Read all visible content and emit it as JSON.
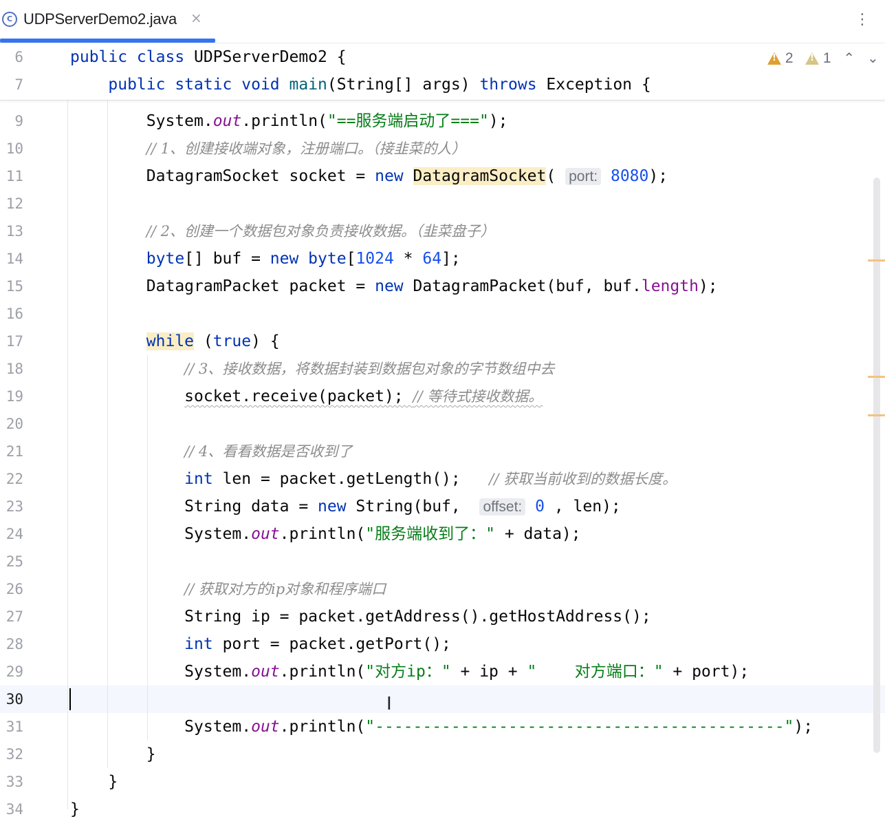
{
  "tab": {
    "icon": "java-class-icon",
    "title": "UDPServerDemo2.java",
    "close": "×"
  },
  "toolbar": {
    "more": "⋮"
  },
  "inspections": {
    "warnings": "2",
    "weak_warnings": "1",
    "up": "⌃",
    "down": "⌄"
  },
  "sticky": [
    {
      "n": "6",
      "code": "public class UDPServerDemo2 {"
    },
    {
      "n": "7",
      "code": "    public static void main(String[] args) throws Exception {"
    }
  ],
  "lines": [
    {
      "n": "9",
      "code": "        System.out.println(\"==服务端启动了===\");"
    },
    {
      "n": "10",
      "code": "        // 1、创建接收端对象，注册端口。（接韭菜的人）"
    },
    {
      "n": "11",
      "code": "        DatagramSocket socket = new DatagramSocket( port: 8080);"
    },
    {
      "n": "12",
      "code": ""
    },
    {
      "n": "13",
      "code": "        // 2、创建一个数据包对象负责接收数据。（韭菜盘子）"
    },
    {
      "n": "14",
      "code": "        byte[] buf = new byte[1024 * 64];"
    },
    {
      "n": "15",
      "code": "        DatagramPacket packet = new DatagramPacket(buf, buf.length);"
    },
    {
      "n": "16",
      "code": ""
    },
    {
      "n": "17",
      "code": "        while (true) {"
    },
    {
      "n": "18",
      "code": "            // 3、接收数据，将数据封装到数据包对象的字节数组中去"
    },
    {
      "n": "19",
      "code": "            socket.receive(packet); // 等待式接收数据。"
    },
    {
      "n": "20",
      "code": ""
    },
    {
      "n": "21",
      "code": "            // 4、看看数据是否收到了"
    },
    {
      "n": "22",
      "code": "            int len = packet.getLength();   // 获取当前收到的数据长度。"
    },
    {
      "n": "23",
      "code": "            String data = new String(buf,  offset: 0 , len);"
    },
    {
      "n": "24",
      "code": "            System.out.println(\"服务端收到了：\" + data);"
    },
    {
      "n": "25",
      "code": ""
    },
    {
      "n": "26",
      "code": "            // 获取对方的ip对象和程序端口"
    },
    {
      "n": "27",
      "code": "            String ip = packet.getAddress().getHostAddress();"
    },
    {
      "n": "28",
      "code": "            int port = packet.getPort();"
    },
    {
      "n": "29",
      "code": "            System.out.println(\"对方ip：\" + ip + \"    对方端口：\" + port);"
    },
    {
      "n": "30",
      "code": ""
    },
    {
      "n": "31",
      "code": "            System.out.println(\"-------------------------------------------\");"
    },
    {
      "n": "32",
      "code": "        }"
    },
    {
      "n": "33",
      "code": "    }"
    },
    {
      "n": "34",
      "code": "}"
    }
  ],
  "colors": {
    "keyword": "#0033b3",
    "number": "#1750eb",
    "string": "#067d17",
    "field": "#871094",
    "comment": "#8c8c8c",
    "accent": "#3574f0",
    "warning": "#e0a02f"
  }
}
